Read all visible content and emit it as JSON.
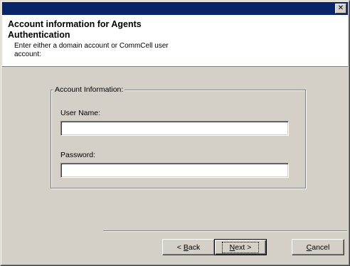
{
  "titlebar": {
    "close_glyph": "✕"
  },
  "header": {
    "title": "Account information for Agents Authentication",
    "subtitle": "Enter either a domain account or CommCell user account:"
  },
  "account_group": {
    "legend": "Account Information:",
    "username_label": "User Name:",
    "username_value": "",
    "password_label": "Password:",
    "password_value": ""
  },
  "buttons": {
    "back": {
      "prefix": "< ",
      "mnemonic": "B",
      "rest": "ack"
    },
    "next": {
      "mnemonic": "N",
      "rest": "ext >"
    },
    "cancel": {
      "mnemonic": "C",
      "rest": "ancel"
    }
  },
  "colors": {
    "titlebar": "#0a246a",
    "dialog_face": "#d4d0c8",
    "header_bg": "#ffffff"
  }
}
